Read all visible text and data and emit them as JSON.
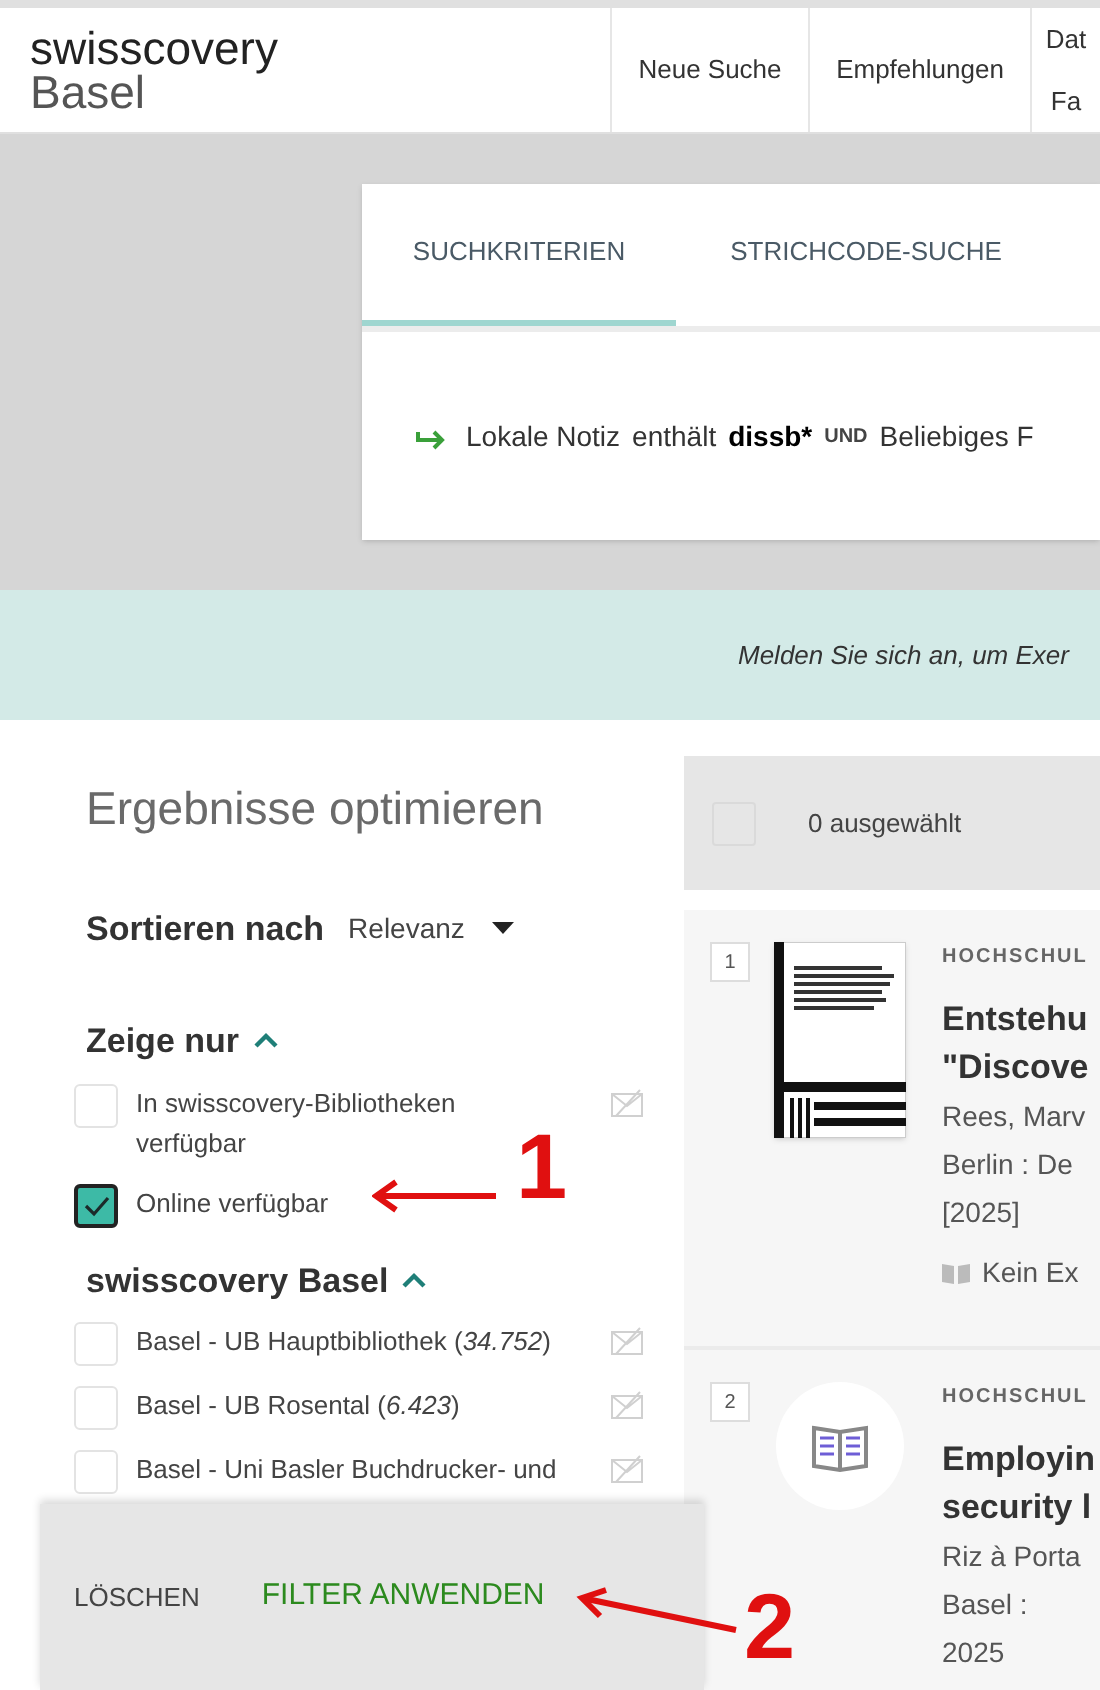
{
  "header": {
    "logo_line1": "swisscovery",
    "logo_line2": "Basel",
    "nav": [
      {
        "lines": [
          "Neue Suche"
        ]
      },
      {
        "lines": [
          "Empfehlungen"
        ]
      },
      {
        "lines": [
          "Dat",
          "Fa"
        ]
      }
    ]
  },
  "search_card": {
    "tabs": [
      {
        "label": "SUCHKRITERIEN",
        "selected": true
      },
      {
        "label": "STRICHCODE-SUCHE",
        "selected": false
      }
    ],
    "query": {
      "field": "Lokale Notiz",
      "operator": "enthält",
      "term": "dissb*",
      "conjunction": "UND",
      "next_field": "Beliebiges F"
    }
  },
  "banner": {
    "text": "Melden Sie sich an, um Exer"
  },
  "refine": {
    "title": "Ergebnisse optimieren",
    "sort": {
      "label": "Sortieren nach",
      "value": "Relevanz"
    },
    "sections": [
      {
        "title": "Zeige nur",
        "expanded": true,
        "items": [
          {
            "label": "In swisscovery-Bibliotheken verfügbar",
            "checked": false,
            "exclude": true
          },
          {
            "label": "Online verfügbar",
            "checked": true,
            "exclude": false
          }
        ]
      },
      {
        "title": "swisscovery Basel",
        "expanded": true,
        "items": [
          {
            "label": "Basel - UB Hauptbibliothek (*34.752*)",
            "checked": false,
            "exclude": true
          },
          {
            "label": "Basel - UB Rosental (*6.423*)",
            "checked": false,
            "exclude": true
          },
          {
            "label": "Basel - Uni Basler Buchdrucker- und",
            "checked": false,
            "exclude": true
          }
        ]
      }
    ],
    "footer": {
      "clear": "LÖSCHEN",
      "apply": "FILTER ANWENDEN"
    }
  },
  "results": {
    "select_all": {
      "checked": false
    },
    "selected_count": "0 ausgewählt",
    "items": [
      {
        "number": "1",
        "kind": "cover",
        "category": "HOCHSCHUL",
        "title_lines": [
          "Entstehu",
          "\"Discove"
        ],
        "details": [
          "Rees, Marv",
          "Berlin : De",
          "[2025]"
        ],
        "availability": "Kein Ex"
      },
      {
        "number": "2",
        "kind": "icon",
        "category": "HOCHSCHUL",
        "title_lines": [
          "Employin",
          "security l"
        ],
        "details": [
          "Riz à Porta",
          "Basel :",
          "2025"
        ]
      }
    ]
  },
  "annotations": [
    {
      "label": "1"
    },
    {
      "label": "2"
    }
  ]
}
